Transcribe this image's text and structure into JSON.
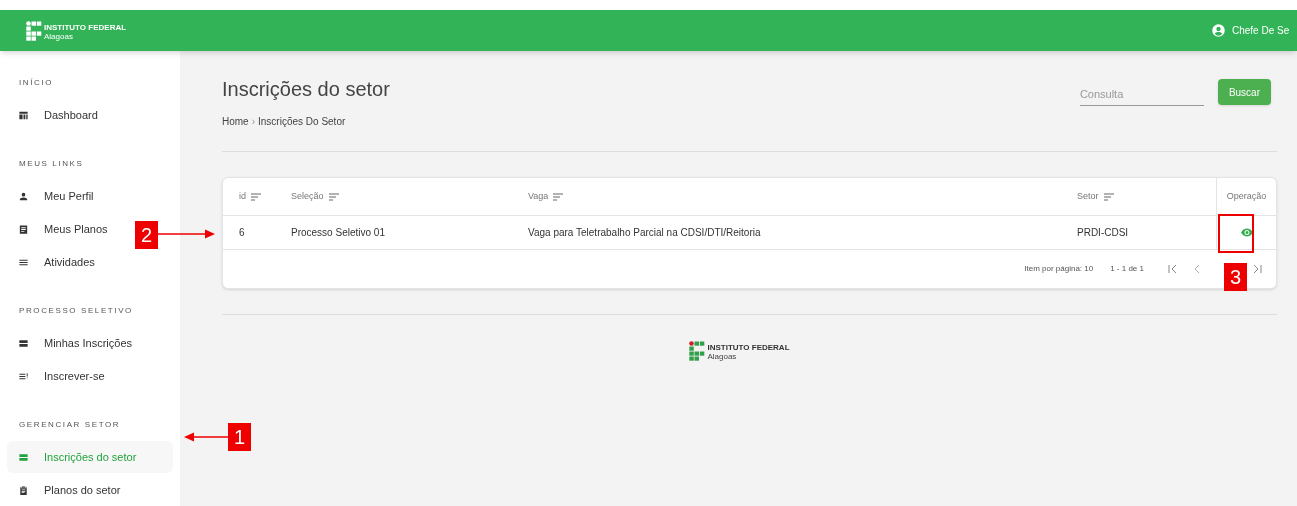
{
  "header": {
    "logo": {
      "title": "INSTITUTO FEDERAL",
      "subtitle": "Alagoas"
    },
    "user": "Chefe De Se"
  },
  "sidebar": {
    "sections": [
      {
        "title": "INÍCIO",
        "items": [
          {
            "label": "Dashboard",
            "selected": false
          }
        ]
      },
      {
        "title": "MEUS LINKS",
        "items": [
          {
            "label": "Meu Perfil",
            "selected": false
          },
          {
            "label": "Meus Planos",
            "selected": false
          },
          {
            "label": "Atividades",
            "selected": false
          }
        ]
      },
      {
        "title": "PROCESSO SELETIVO",
        "items": [
          {
            "label": "Minhas Inscrições",
            "selected": false
          },
          {
            "label": "Inscrever-se",
            "selected": false
          }
        ]
      },
      {
        "title": "GERENCIAR SETOR",
        "items": [
          {
            "label": "Inscrições do setor",
            "selected": true
          },
          {
            "label": "Planos do setor",
            "selected": false
          }
        ]
      }
    ]
  },
  "page": {
    "title": "Inscrições do setor",
    "breadcrumb": [
      "Home",
      "Inscrições Do Setor"
    ],
    "breadcrumb_separator": "›",
    "search": {
      "placeholder": "Consulta"
    },
    "search_button": "Buscar"
  },
  "table": {
    "columns": [
      {
        "label": "id",
        "sortable": true
      },
      {
        "label": "Seleção",
        "sortable": true
      },
      {
        "label": "Vaga",
        "sortable": true
      },
      {
        "label": "Setor",
        "sortable": true
      },
      {
        "label": "Operação",
        "sortable": false
      }
    ],
    "rows": [
      {
        "cells": [
          "6",
          "Processo Seletivo 01",
          "Vaga para Teletrabalho Parcial na CDSI/DTI/Reitoria",
          "PRDI-CDSI"
        ]
      }
    ],
    "pagination": {
      "items_per_page": "Item por página: 10",
      "range": "1 - 1 de 1"
    }
  },
  "footer": {
    "logo": {
      "title": "INSTITUTO FEDERAL",
      "subtitle": "Alagoas"
    }
  },
  "annotations": [
    {
      "label": "1"
    },
    {
      "label": "2"
    },
    {
      "label": "3"
    }
  ]
}
